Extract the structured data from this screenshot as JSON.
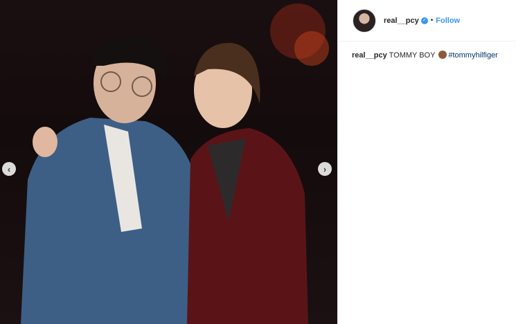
{
  "post": {
    "username": "real__pcy",
    "follow_label": "Follow",
    "separator": "•",
    "verified_glyph": "✓",
    "caption_text": "TOMMY BOY",
    "hashtag": "#tommyhilfiger"
  },
  "carousel": {
    "prev_glyph": "‹",
    "next_glyph": "›"
  }
}
